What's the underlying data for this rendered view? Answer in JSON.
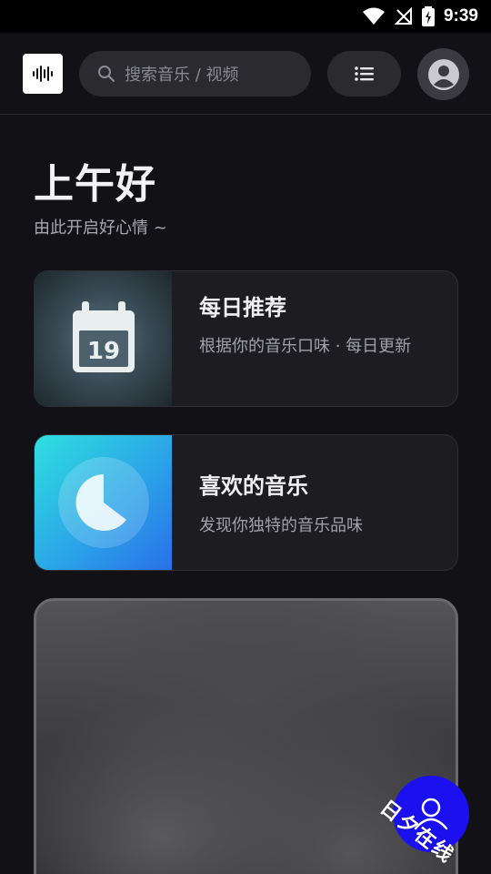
{
  "status_bar": {
    "time": "9:39",
    "icons": [
      "wifi-icon",
      "no-signal-icon",
      "battery-charging-icon"
    ]
  },
  "header": {
    "logo_icon": "waveform-icon",
    "search": {
      "placeholder": "搜索音乐 / 视频",
      "icon": "search-icon"
    },
    "menu_icon": "list-icon",
    "avatar_icon": "user-avatar-icon"
  },
  "greeting": {
    "title": "上午好",
    "subtitle": "由此开启好心情 ~"
  },
  "cards": [
    {
      "title": "每日推荐",
      "desc": "根据你的音乐口味 · 每日更新",
      "icon": "calendar-icon",
      "calendar_day": "19"
    },
    {
      "title": "喜欢的音乐",
      "desc": "发现你独特的音乐品味",
      "icon": "music-disc-icon"
    }
  ],
  "fab": {
    "icon": "user-icon"
  },
  "watermark": "日夕在线",
  "colors": {
    "background": "#121216",
    "card": "#1c1c21",
    "fab": "#1a10f0",
    "liked_gradient_start": "#2fe0e0",
    "liked_gradient_end": "#2a6fe8"
  }
}
